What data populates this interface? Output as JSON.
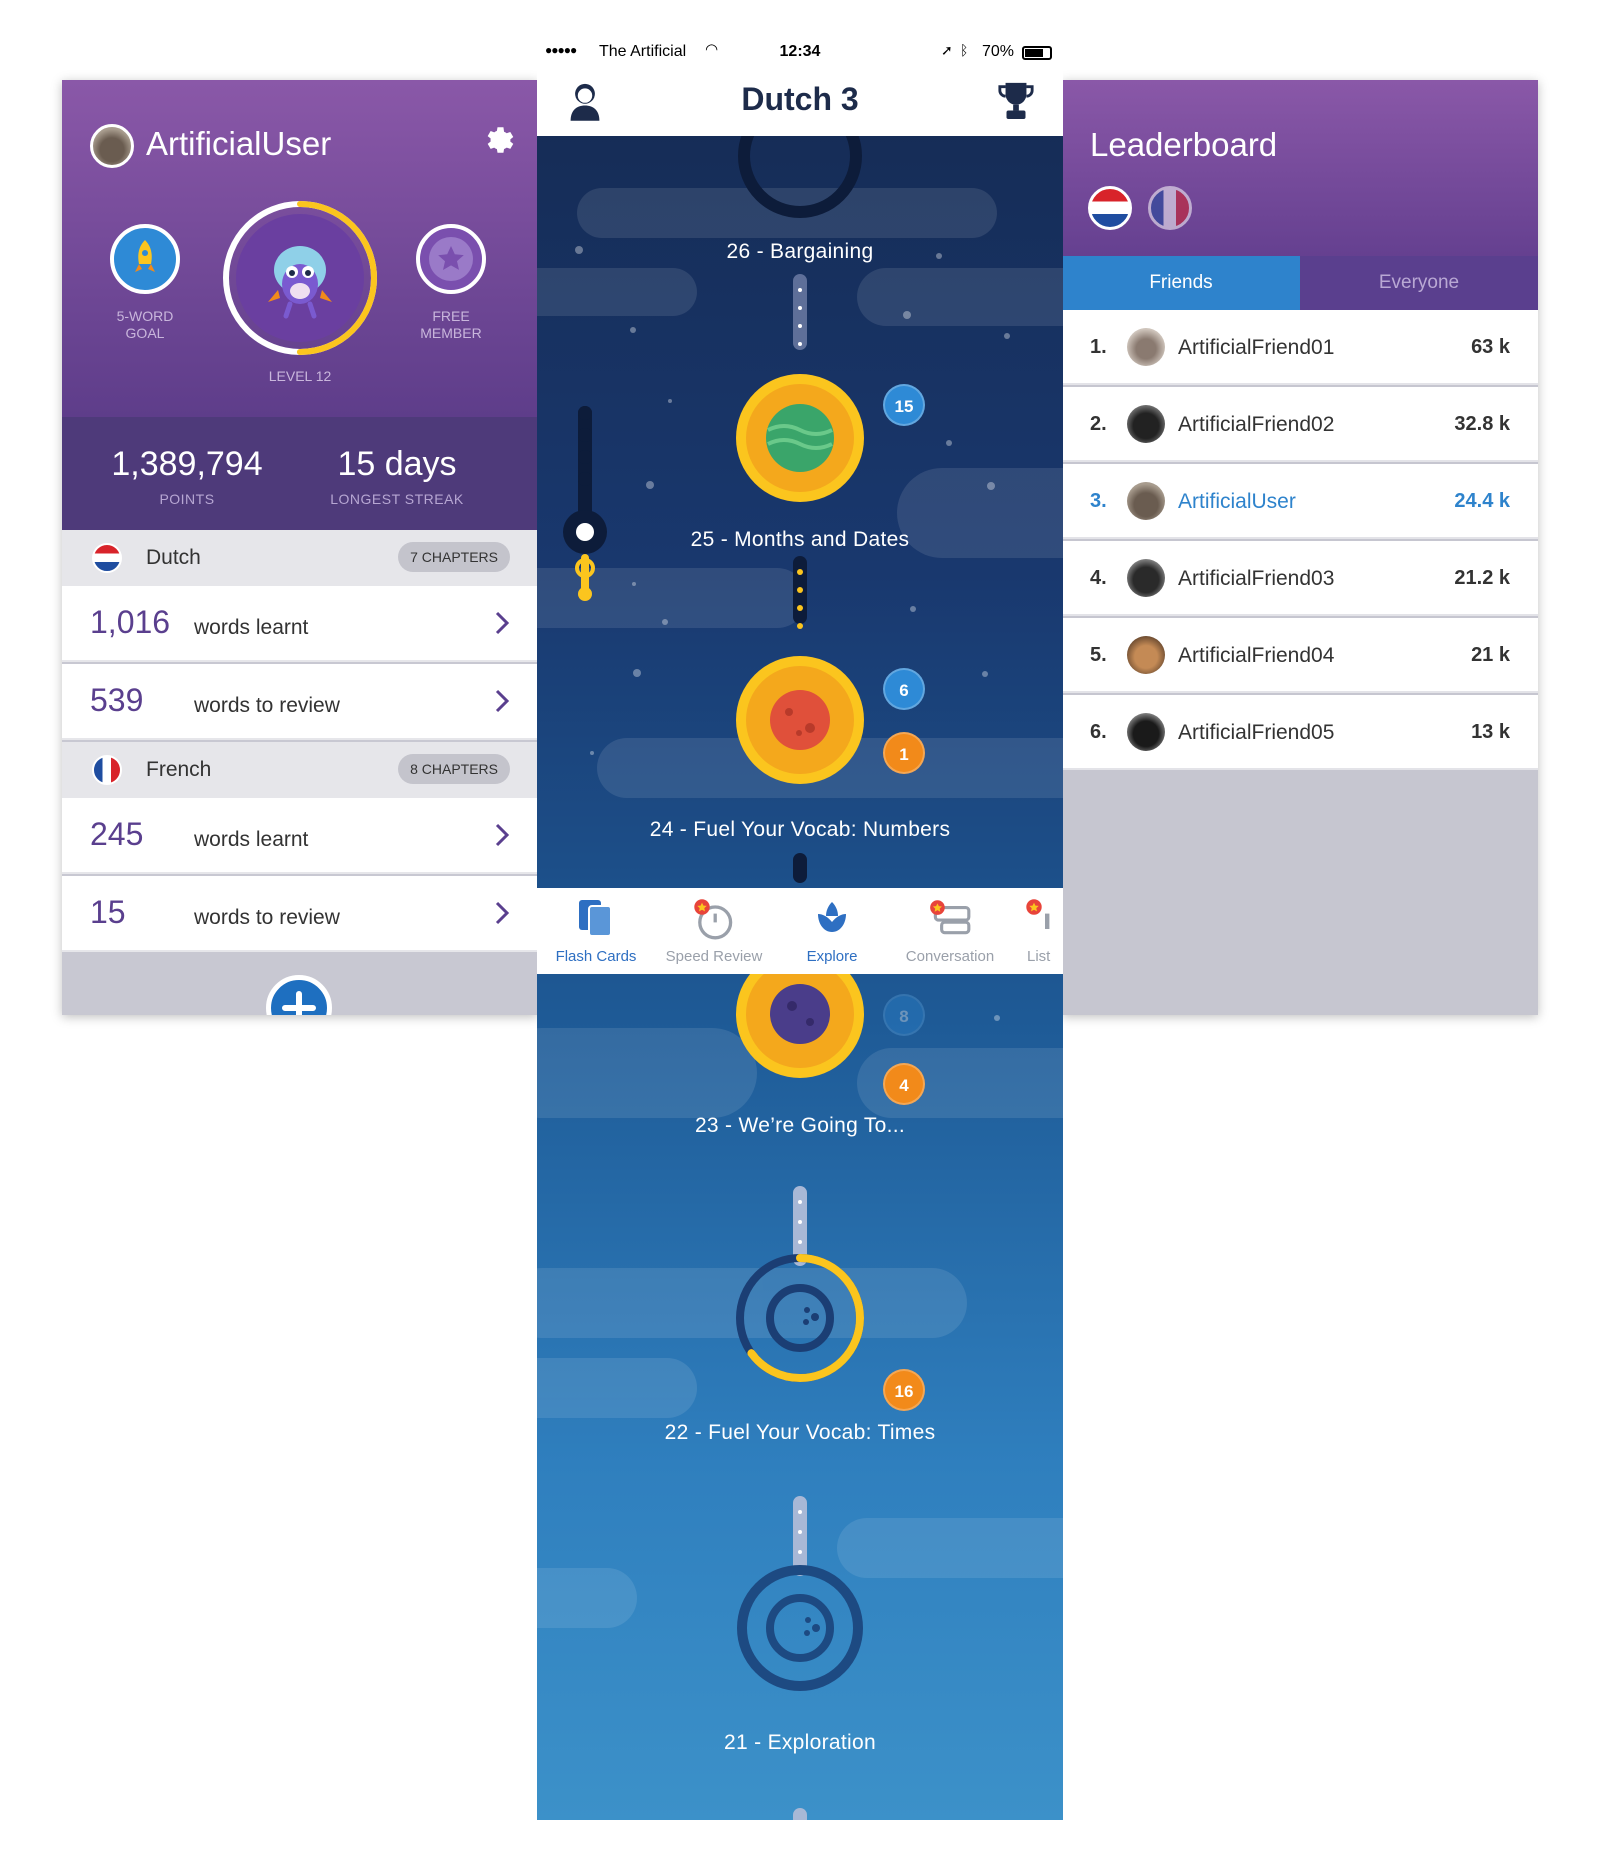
{
  "profile": {
    "username": "ArtificialUser",
    "goal_caption": "5-WORD GOAL",
    "member_caption": "FREE MEMBER",
    "level_caption": "LEVEL 12",
    "level_progress": 0.5,
    "points_value": "1,389,794",
    "points_label": "POINTS",
    "streak_value": "15 days",
    "streak_label": "LONGEST STREAK",
    "languages": [
      {
        "name": "Dutch",
        "chapters": "7 CHAPTERS",
        "learnt_value": "1,016",
        "learnt_label": "words learnt",
        "review_value": "539",
        "review_label": "words to review"
      },
      {
        "name": "French",
        "chapters": "8 CHAPTERS",
        "learnt_value": "245",
        "learnt_label": "words learnt",
        "review_value": "15",
        "review_label": "words to review"
      }
    ]
  },
  "phone": {
    "status": {
      "carrier": "The Artificial",
      "time": "12:34",
      "battery": "70%"
    },
    "course_title": "Dutch 3",
    "lessons": [
      {
        "title": "26 - Bargaining"
      },
      {
        "title": "25 - Months and Dates",
        "badge_blue": "15"
      },
      {
        "title": "24 - Fuel Your Vocab: Numbers",
        "badge_blue": "6",
        "badge_orange": "1"
      },
      {
        "title": "23 - We’re Going To...",
        "badge_blue": "8",
        "badge_orange": "4"
      },
      {
        "title": "22 - Fuel Your Vocab: Times",
        "badge_orange": "16",
        "progress": 0.65
      },
      {
        "title": "21 - Exploration"
      }
    ],
    "tabs": [
      {
        "label": "Flash Cards",
        "active": true
      },
      {
        "label": "Speed Review"
      },
      {
        "label": "Explore",
        "active": true
      },
      {
        "label": "Conversation"
      },
      {
        "label": "List"
      }
    ]
  },
  "leaderboard": {
    "title": "Leaderboard",
    "tab_friends": "Friends",
    "tab_everyone": "Everyone",
    "rows": [
      {
        "rank": "1.",
        "name": "ArtificialFriend01",
        "score": "63 k"
      },
      {
        "rank": "2.",
        "name": "ArtificialFriend02",
        "score": "32.8 k"
      },
      {
        "rank": "3.",
        "name": "ArtificialUser",
        "score": "24.4 k",
        "is_me": true
      },
      {
        "rank": "4.",
        "name": "ArtificialFriend03",
        "score": "21.2 k"
      },
      {
        "rank": "5.",
        "name": "ArtificialFriend04",
        "score": "21 k"
      },
      {
        "rank": "6.",
        "name": "ArtificialFriend05",
        "score": "13 k"
      }
    ]
  },
  "colors": {
    "purple": "#7b4fa0",
    "accent_blue": "#2e83cc",
    "badge_orange": "#f28a1a",
    "planet_yellow": "#fbc51e"
  }
}
